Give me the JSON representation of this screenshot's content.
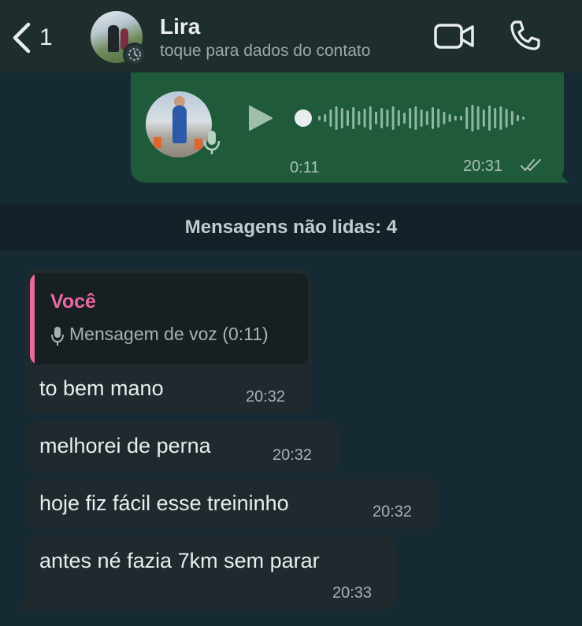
{
  "header": {
    "back_count": "1",
    "contact_name": "Lira",
    "contact_subtitle": "toque para dados do contato",
    "icons": [
      "chevron-left-icon",
      "status-clock-icon",
      "video-call-icon",
      "phone-icon"
    ]
  },
  "voice_message": {
    "duration": "0:11",
    "time": "20:31",
    "icons": [
      "play-icon",
      "mic-icon",
      "double-check-icon"
    ]
  },
  "unread_banner": "Mensagens não lidas: 4",
  "messages": [
    {
      "quote_author": "Você",
      "quote_text": "Mensagem de voz (0:11)",
      "text": "to bem mano",
      "time": "20:32"
    },
    {
      "text": "melhorei de perna",
      "time": "20:32"
    },
    {
      "text": "hoje fiz fácil esse treininho",
      "time": "20:32"
    },
    {
      "text": "antes né fazia 7km sem parar",
      "time": "20:33"
    }
  ],
  "colors": {
    "background": "#162a33",
    "header": "#1e2e2c",
    "outgoing_bubble": "#1f5a3b",
    "incoming_bubble": "#202a2e",
    "quote_accent": "#ea6aa0"
  }
}
